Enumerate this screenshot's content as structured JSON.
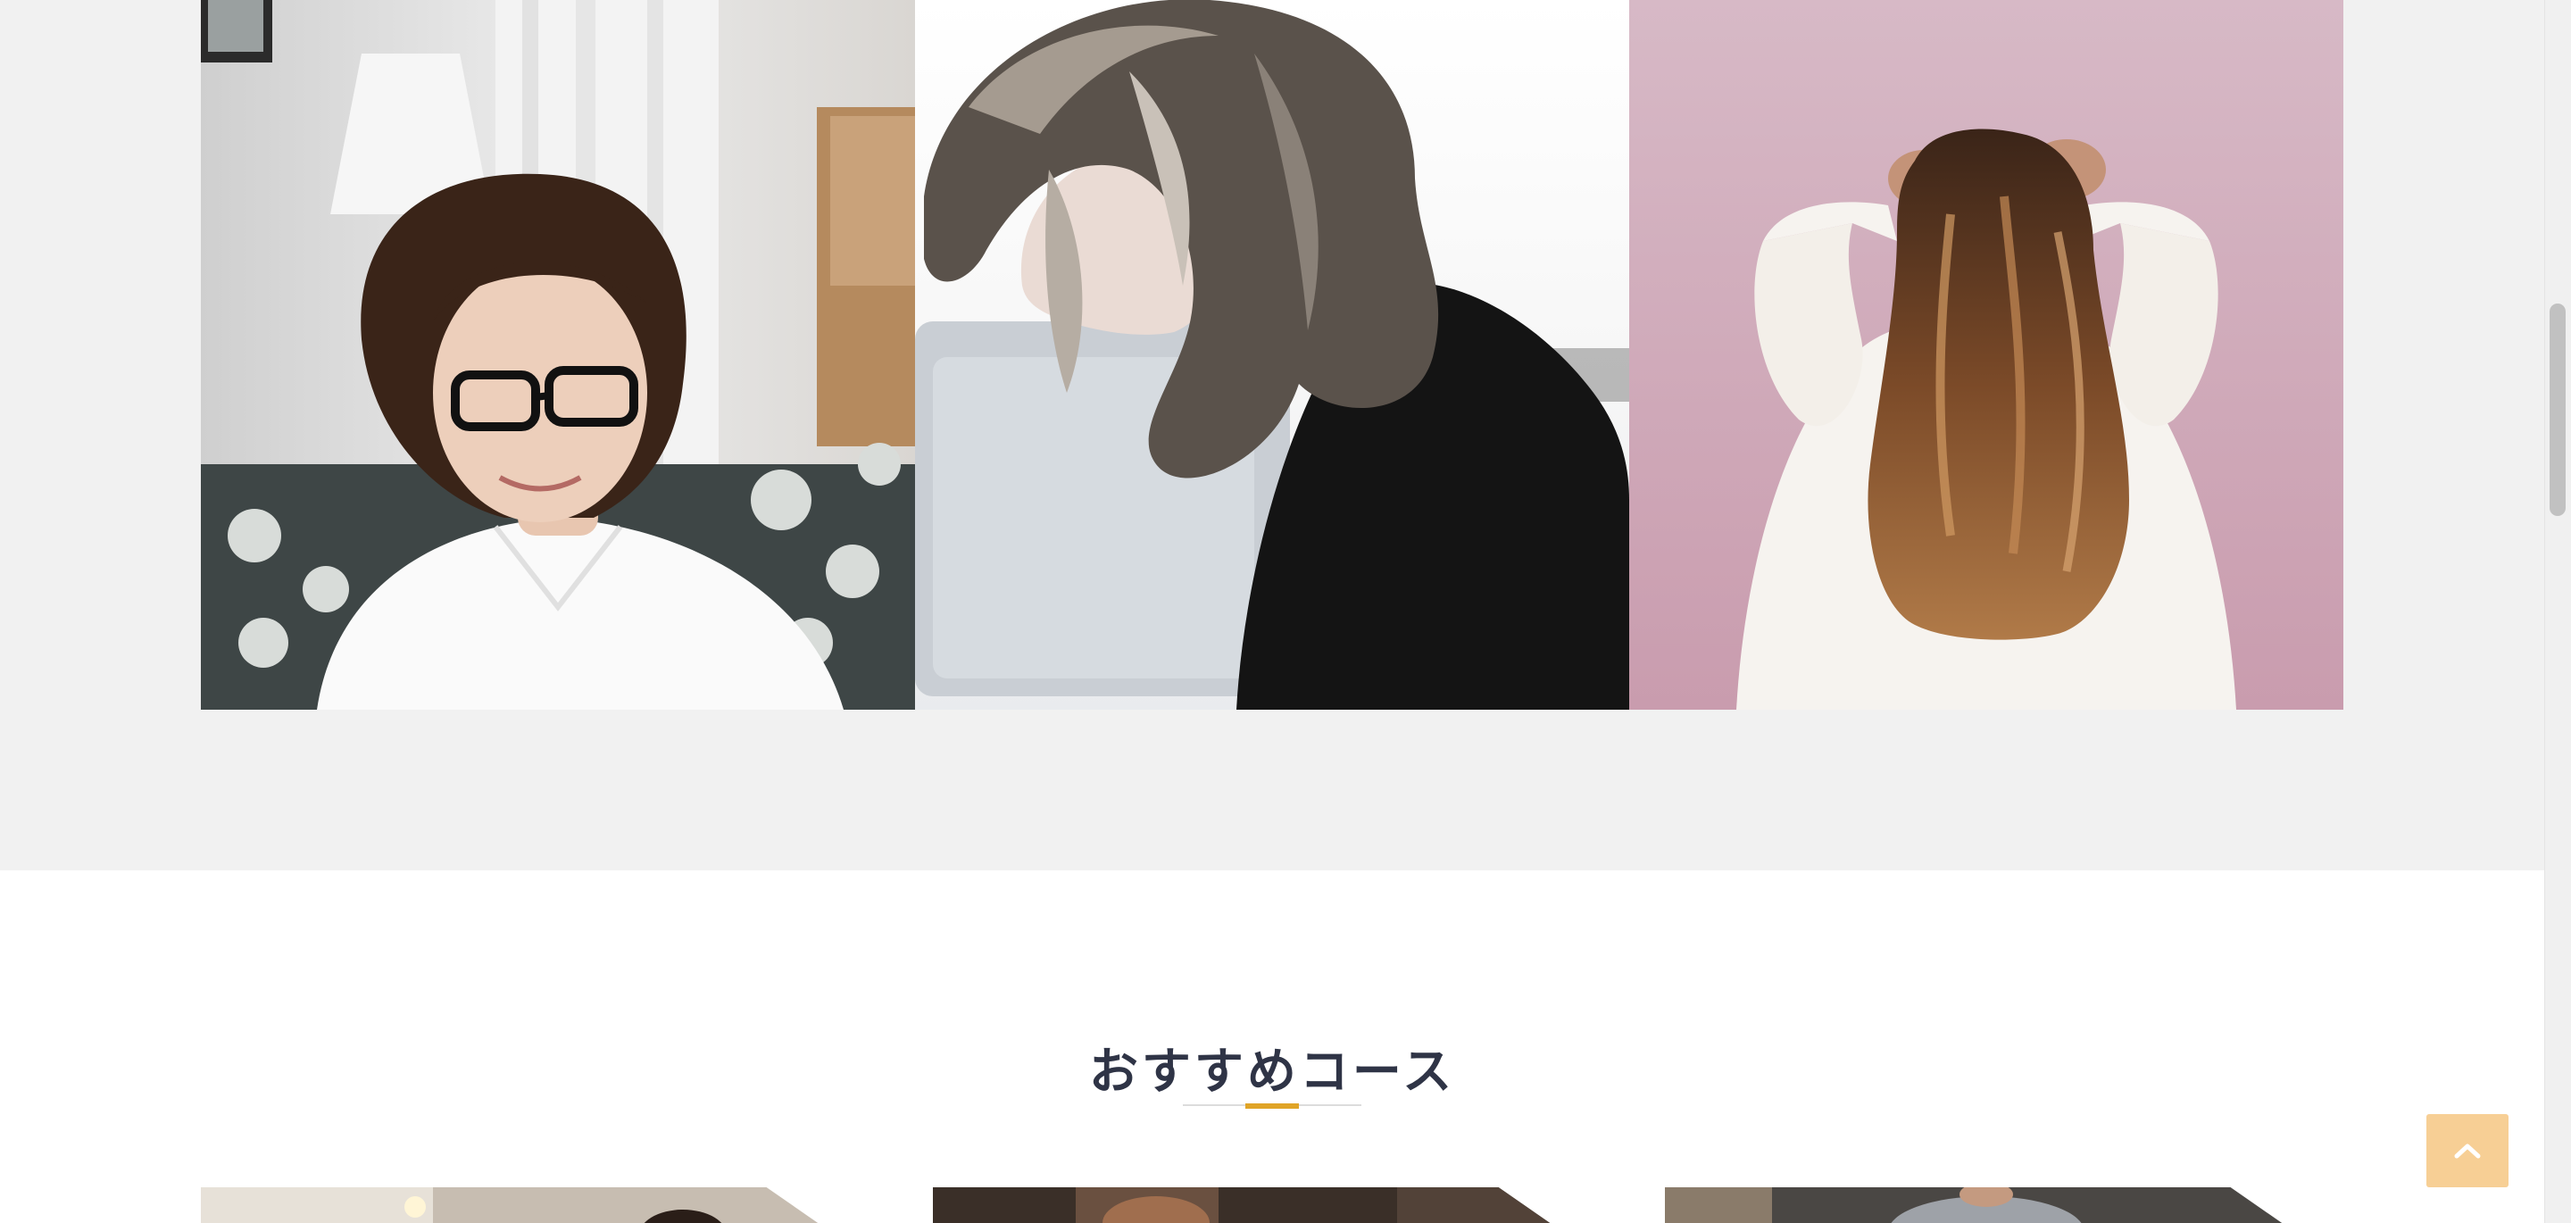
{
  "gallery": {
    "photos": [
      {
        "name": "woman-with-glasses-photo",
        "icon": "photo"
      },
      {
        "name": "woman-short-wavy-hair-photo",
        "icon": "photo"
      },
      {
        "name": "woman-long-wavy-hair-photo",
        "icon": "photo"
      }
    ]
  },
  "courses": {
    "title": "おすすめコース",
    "accent_color": "#e0a427",
    "cards": [
      {
        "name": "course-card-1"
      },
      {
        "name": "course-card-2"
      },
      {
        "name": "course-card-3"
      }
    ]
  },
  "back_to_top": {
    "icon": "chevron-up-icon",
    "background": "#f7cf95"
  }
}
